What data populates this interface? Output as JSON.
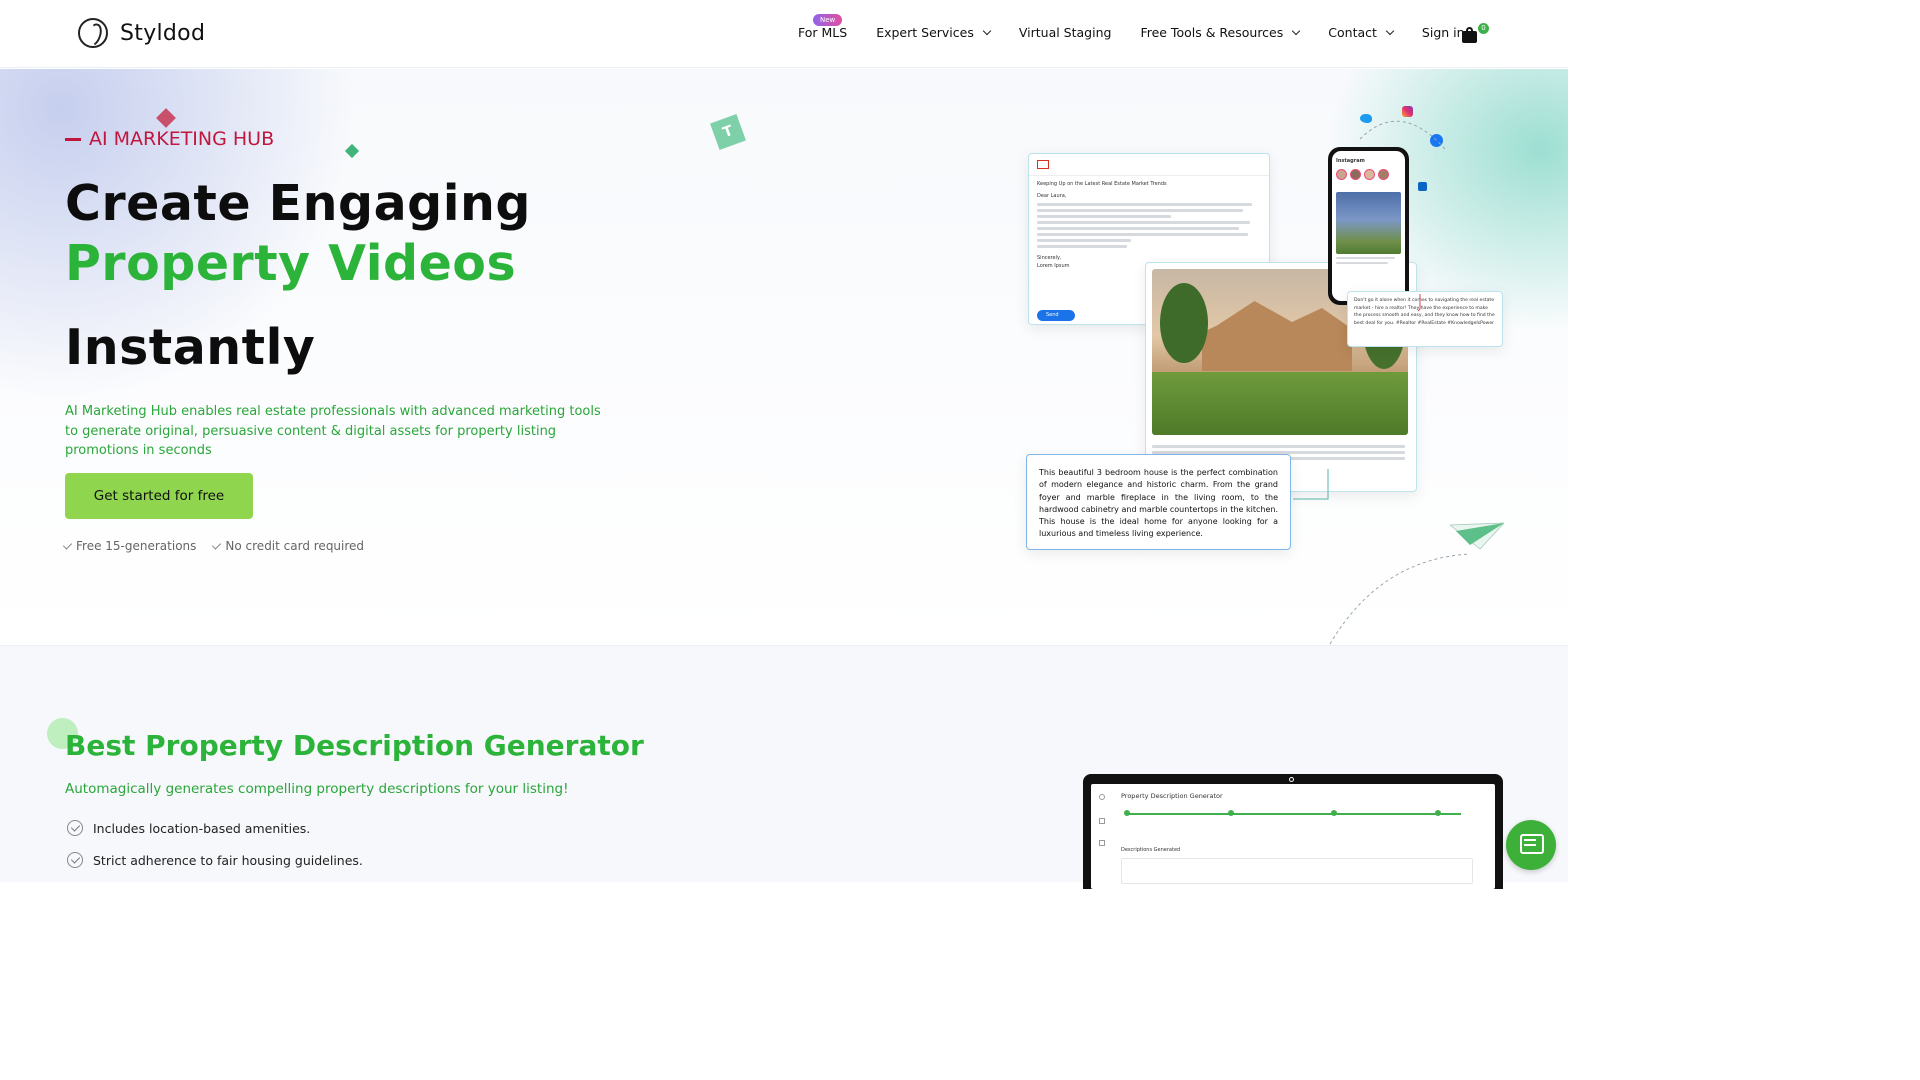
{
  "header": {
    "logo_text": "Styldod",
    "nav": [
      {
        "label": "For MLS",
        "badge": "New"
      },
      {
        "label": "Expert Services"
      },
      {
        "label": "Virtual Staging"
      },
      {
        "label": "Free Tools & Resources"
      },
      {
        "label": "Contact"
      },
      {
        "label": "Sign in"
      }
    ],
    "cart_count": "0"
  },
  "hero": {
    "eyebrow": "AI MARKETING HUB",
    "title_line1": "Create Engaging",
    "title_line2": "Property Videos",
    "title_line3": "Instantly",
    "description": "AI Marketing Hub enables real estate professionals with advanced marketing tools to generate original, persuasive content & digital assets for property listing promotions in seconds",
    "cta_label": "Get started for free",
    "checks": [
      "Free 15-generations",
      "No credit card required"
    ],
    "email_mock": {
      "subject": "Keeping Up on the Latest Real Estate Market Trends",
      "greeting": "Dear Laura,",
      "signoff": "Sincerely,",
      "name": "Lorem Ipsum",
      "send": "Send"
    },
    "social_caption": "Don't go it alone when it comes to navigating the real estate market - hire a realtor! They have the experience to make the process smooth and easy, and they know how to find the best deal for you. #Realtor #RealEstate #KnowledgeIsPower",
    "listing_description": "This beautiful 3 bedroom house is the perfect combination of modern elegance and historic charm. From the grand foyer and marble fireplace in the living room, to the hardwood cabinetry and marble countertops in the kitchen. This house is the ideal home for anyone looking for a luxurious and timeless living experience.",
    "instagram_label": "Instagram",
    "badge_letter": "T"
  },
  "section2": {
    "title": "Best Property Description Generator",
    "subtitle": "Automagically generates compelling property descriptions for your listing!",
    "features": [
      "Includes location-based amenities.",
      "Strict adherence to fair housing guidelines."
    ],
    "laptop_title": "Property Description Generator",
    "laptop_section": "Descriptions Generated"
  },
  "colors": {
    "accent_green": "#2cb43a",
    "cta_green": "#8fd54e",
    "eyebrow_red": "#c0173f"
  }
}
